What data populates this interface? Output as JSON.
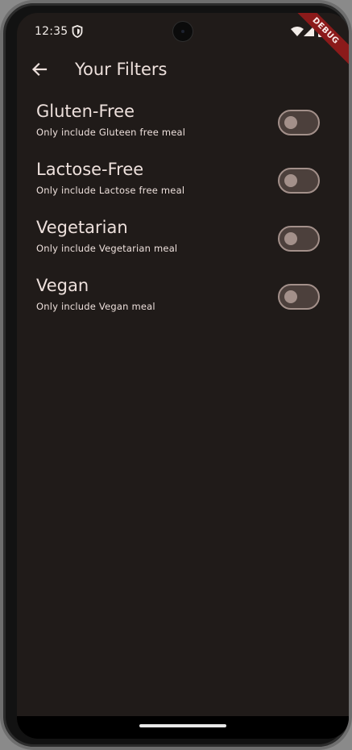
{
  "status_bar": {
    "time": "12:35",
    "icons": [
      "shield-icon",
      "wifi-icon",
      "signal-icon",
      "battery-icon"
    ]
  },
  "debug_banner": "DEBUG",
  "app_bar": {
    "back_icon": "arrow-back-icon",
    "title": "Your Filters"
  },
  "filters": [
    {
      "title": "Gluten-Free",
      "subtitle": "Only include Gluteen free meal",
      "enabled": false
    },
    {
      "title": "Lactose-Free",
      "subtitle": "Only include Lactose free meal",
      "enabled": false
    },
    {
      "title": "Vegetarian",
      "subtitle": "Only include Vegetarian meal",
      "enabled": false
    },
    {
      "title": "Vegan",
      "subtitle": "Only include Vegan meal",
      "enabled": false
    }
  ],
  "colors": {
    "background": "#201b19",
    "text": "#ede0dc",
    "switch_track": "#4c403c",
    "switch_outline": "#a3908a",
    "debug_ribbon": "#8b1a1a"
  }
}
